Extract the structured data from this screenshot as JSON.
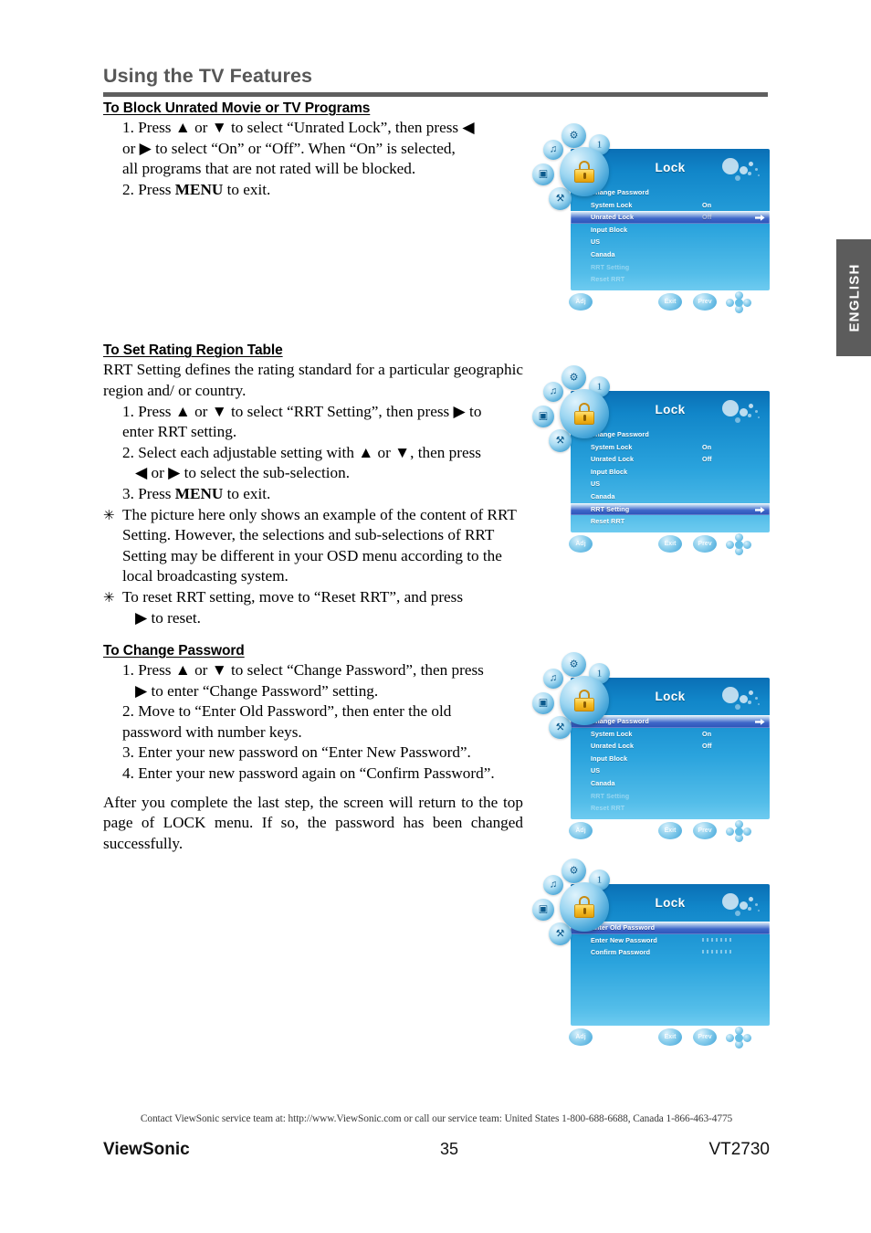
{
  "header": {
    "title": "Using the TV Features"
  },
  "lang_tab": {
    "label": "ENGLISH"
  },
  "sections": {
    "block_unrated": {
      "heading": "To Block Unrated Movie or TV Programs",
      "step1_a": "1. Press ▲ or ▼ to select “Unrated Lock”, then press ◀",
      "step1_b": "or ▶ to select “On” or “Off”. When “On” is selected,",
      "step1_c": "all programs that are not rated will be blocked.",
      "step2_pre": "2. Press ",
      "step2_key": "MENU",
      "step2_post": " to exit."
    },
    "rating_region": {
      "heading": "To Set Rating Region Table",
      "intro": "RRT Setting defines the rating standard for a particular geographic region and/ or country.",
      "step1_a": "1. Press ▲ or ▼ to select “RRT Setting”, then press ▶ to",
      "step1_b": "enter RRT setting.",
      "step2_a": "2. Select each adjustable setting with ▲ or ▼, then press",
      "step2_b": "◀ or ▶ to select the sub-selection.",
      "step3_pre": "3. Press ",
      "step3_key": "MENU",
      "step3_post": " to exit.",
      "note1": "The picture here only shows an example of the content of RRT Setting. However, the selections and sub-selections of RRT Setting may be different in your OSD menu according to the local broadcasting system.",
      "note2_a": "To reset RRT setting, move to “Reset RRT”, and press",
      "note2_b": "▶ to reset.",
      "star": "✳"
    },
    "change_password": {
      "heading": "To Change Password",
      "step1_a": "1. Press ▲ or ▼ to select “Change Password”, then press",
      "step1_b": "▶ to enter “Change Password” setting.",
      "step2_a": "2. Move to “Enter Old Password”, then enter the old",
      "step2_b": "password with number keys.",
      "step3": "3. Enter your new password on “Enter New Password”.",
      "step4": "4. Enter your new password again on “Confirm Password”.",
      "closing": "After you complete the last step, the screen will return to the top page of LOCK menu. If so, the password has been changed successfully."
    }
  },
  "osd": {
    "title": "Lock",
    "buttons": {
      "adj": "Adj",
      "exit": "Exit",
      "prev": "Prev"
    },
    "screens": [
      {
        "id": "osd-unrated-lock",
        "rows": [
          {
            "label": "Change Password",
            "value": "",
            "state": "normal",
            "arrow": false
          },
          {
            "label": "System Lock",
            "value": "On",
            "state": "normal",
            "arrow": false
          },
          {
            "label": "Unrated Lock",
            "value": "Off",
            "state": "selected",
            "arrow": true
          },
          {
            "label": "Input Block",
            "value": "",
            "state": "normal",
            "arrow": false
          },
          {
            "label": "US",
            "value": "",
            "state": "normal",
            "arrow": false
          },
          {
            "label": "Canada",
            "value": "",
            "state": "normal",
            "arrow": false
          },
          {
            "label": "RRT Setting",
            "value": "",
            "state": "dim",
            "arrow": false
          },
          {
            "label": "Reset RRT",
            "value": "",
            "state": "dim",
            "arrow": false
          }
        ]
      },
      {
        "id": "osd-rrt-setting",
        "rows": [
          {
            "label": "Change Password",
            "value": "",
            "state": "normal",
            "arrow": false
          },
          {
            "label": "System Lock",
            "value": "On",
            "state": "normal",
            "arrow": false
          },
          {
            "label": "Unrated Lock",
            "value": "Off",
            "state": "normal",
            "arrow": false
          },
          {
            "label": "Input Block",
            "value": "",
            "state": "normal",
            "arrow": false
          },
          {
            "label": "US",
            "value": "",
            "state": "normal",
            "arrow": false
          },
          {
            "label": "Canada",
            "value": "",
            "state": "normal",
            "arrow": false
          },
          {
            "label": "RRT Setting",
            "value": "",
            "state": "selected",
            "arrow": true
          },
          {
            "label": "Reset RRT",
            "value": "",
            "state": "normal",
            "arrow": false
          }
        ]
      },
      {
        "id": "osd-change-password",
        "rows": [
          {
            "label": "Change Password",
            "value": "",
            "state": "selected",
            "arrow": true
          },
          {
            "label": "System Lock",
            "value": "On",
            "state": "normal",
            "arrow": false
          },
          {
            "label": "Unrated Lock",
            "value": "Off",
            "state": "normal",
            "arrow": false
          },
          {
            "label": "Input Block",
            "value": "",
            "state": "normal",
            "arrow": false
          },
          {
            "label": "US",
            "value": "",
            "state": "normal",
            "arrow": false
          },
          {
            "label": "Canada",
            "value": "",
            "state": "normal",
            "arrow": false
          },
          {
            "label": "RRT Setting",
            "value": "",
            "state": "dim",
            "arrow": false
          },
          {
            "label": "Reset RRT",
            "value": "",
            "state": "dim",
            "arrow": false
          }
        ]
      },
      {
        "id": "osd-password-entry",
        "rows": [
          {
            "label": "Enter Old Password",
            "value": "",
            "state": "selected",
            "arrow": false
          },
          {
            "label": "Enter New Password",
            "value": "",
            "state": "normal",
            "arrow": false,
            "dots": true
          },
          {
            "label": "Confirm Password",
            "value": "",
            "state": "normal",
            "arrow": false,
            "dots": true
          }
        ]
      }
    ]
  },
  "footer": {
    "contact": "Contact ViewSonic service team at: http://www.ViewSonic.com or call our service team: United States 1-800-688-6688, Canada 1-866-463-4775",
    "brand": "ViewSonic",
    "page_number": "35",
    "model": "VT2730"
  },
  "colors": {
    "header_gray": "#575757",
    "rule_gray": "#5f5f5f",
    "tab_gray": "#5c5c5c",
    "osd_blue_top": "#0a6fb5",
    "osd_blue_bottom": "#6ecbf0",
    "osd_highlight": "#2b51b8",
    "lock_yellow": "#f7c02a"
  }
}
